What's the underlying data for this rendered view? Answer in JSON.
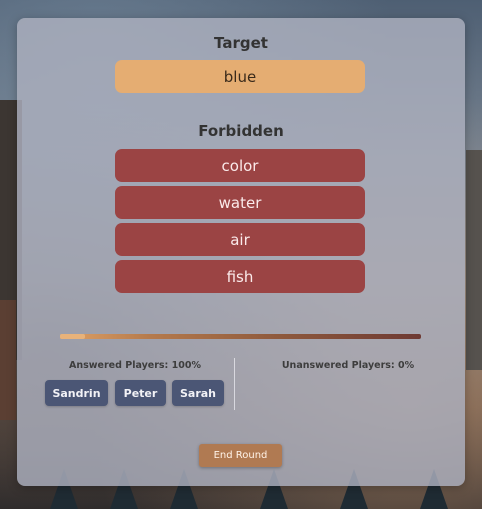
{
  "target": {
    "title": "Target",
    "word": "blue"
  },
  "forbidden": {
    "title": "Forbidden",
    "words": [
      "color",
      "water",
      "air",
      "fish"
    ]
  },
  "progress": {
    "remaining_fraction": 0.07
  },
  "answered": {
    "label": "Answered Players: 100%",
    "players": [
      "Sandrin",
      "Peter",
      "Sarah"
    ]
  },
  "unanswered": {
    "label": "Unanswered Players: 0%"
  },
  "actions": {
    "end_round_label": "End Round"
  },
  "colors": {
    "target_pill": "#e5ad72",
    "forbidden_pill": "#9b4444",
    "player_button": "#4b5675",
    "end_button": "#b07a52"
  }
}
